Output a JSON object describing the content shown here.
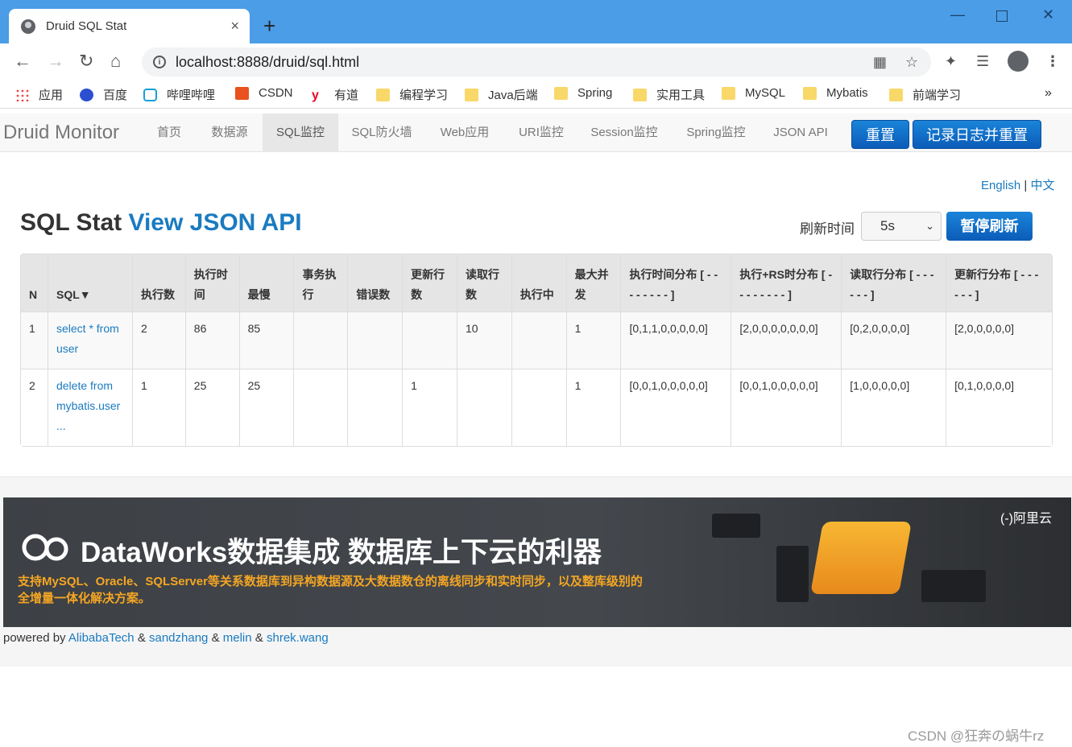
{
  "browser": {
    "tab_title": "Druid SQL Stat",
    "tab_close": "×",
    "new_tab": "+",
    "url": "localhost:8888/druid/sql.html",
    "bookmarks": [
      "应用",
      "百度",
      "哔哩哔哩",
      "CSDN",
      "有道",
      "编程学习",
      "Java后端",
      "Spring",
      "实用工具",
      "MySQL",
      "Mybatis",
      "前端学习"
    ],
    "more": "»"
  },
  "nav": {
    "brand": "Druid Monitor",
    "items": [
      "首页",
      "数据源",
      "SQL监控",
      "SQL防火墙",
      "Web应用",
      "URI监控",
      "Session监控",
      "Spring监控",
      "JSON API"
    ],
    "active_index": 2,
    "reset_label": "重置",
    "log_reset_label": "记录日志并重置"
  },
  "lang": {
    "english": "English",
    "sep": "|",
    "chinese": "中文"
  },
  "heading": {
    "title": "SQL Stat",
    "link": "View JSON API"
  },
  "refresh": {
    "label": "刷新时间",
    "value": "5s",
    "pause_label": "暂停刷新"
  },
  "table": {
    "headers": [
      "N",
      "SQL▼",
      "执行数",
      "执行时间",
      "最慢",
      "事务执行",
      "错误数",
      "更新行数",
      "读取行数",
      "执行中",
      "最大并发",
      "执行时间分布 [ - - - - - - - - ]",
      "执行+RS时分布 [ - - - - - - - - ]",
      "读取行分布 [ - - - - - - ]",
      "更新行分布 [ - - - - - - ]"
    ],
    "rows": [
      [
        "1",
        "select * from user",
        "2",
        "86",
        "85",
        "",
        "",
        "",
        "10",
        "",
        "1",
        "[0,1,1,0,0,0,0,0]",
        "[2,0,0,0,0,0,0,0]",
        "[0,2,0,0,0,0]",
        "[2,0,0,0,0,0]"
      ],
      [
        "2",
        "delete from mybatis.user ...",
        "1",
        "25",
        "25",
        "",
        "",
        "1",
        "",
        "",
        "1",
        "[0,0,1,0,0,0,0,0]",
        "[0,0,1,0,0,0,0,0]",
        "[1,0,0,0,0,0]",
        "[0,1,0,0,0,0]"
      ]
    ]
  },
  "banner": {
    "title": "DataWorks数据集成 数据库上下云的利器",
    "subtitle": "支持MySQL、Oracle、SQLServer等关系数据库到异构数据源及大数据数仓的离线同步和实时同步，以及整库级别的全增量一体化解决方案。",
    "brand": "(-)阿里云"
  },
  "footer": {
    "powered_by": "powered by",
    "links": [
      "AlibabaTech",
      "sandzhang",
      "melin",
      "shrek.wang"
    ],
    "amp": "&"
  },
  "watermark": "CSDN @狂奔の蜗牛rz"
}
